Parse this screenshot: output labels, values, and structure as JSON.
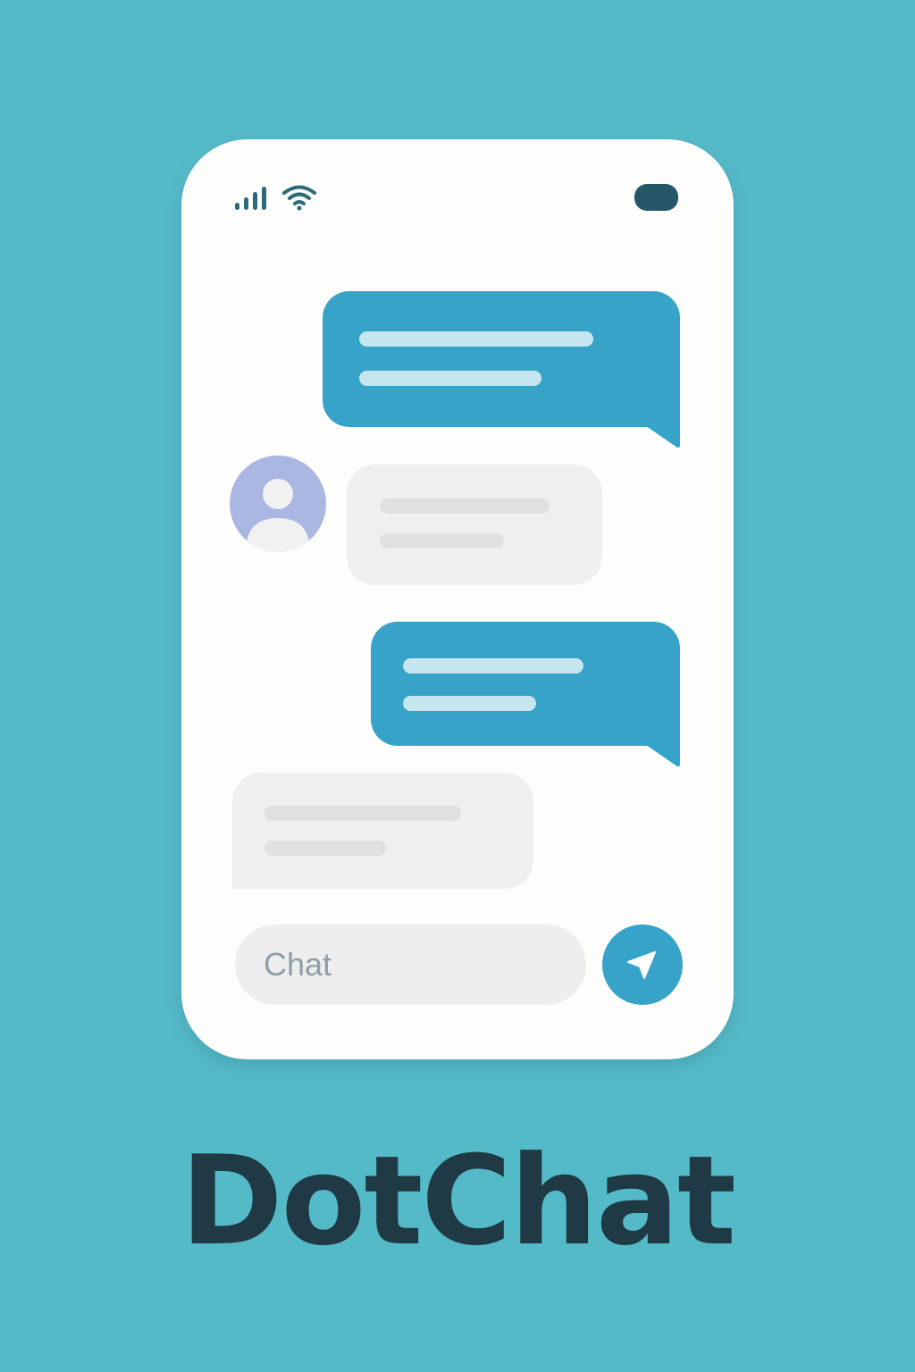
{
  "status_bar": {
    "signal_icon": "signal-bars-icon",
    "wifi_icon": "wifi-icon",
    "battery_icon": "battery-icon"
  },
  "messages": [
    {
      "direction": "outgoing",
      "text_lines": 2
    },
    {
      "direction": "incoming",
      "text_lines": 2,
      "avatar_icon": "user-avatar-icon"
    },
    {
      "direction": "outgoing",
      "text_lines": 2
    },
    {
      "direction": "incoming",
      "text_lines": 2
    }
  ],
  "composer": {
    "placeholder": "Chat",
    "send_icon": "paper-plane-icon"
  },
  "brand": {
    "name": "DotChat"
  },
  "colors": {
    "background": "#55bac8",
    "phone_surface": "#fdfdfb",
    "outgoing_bubble": "#37a3c8",
    "incoming_bubble": "#efefed",
    "avatar": "#aab7e3",
    "brand_text": "#1f3a44"
  }
}
